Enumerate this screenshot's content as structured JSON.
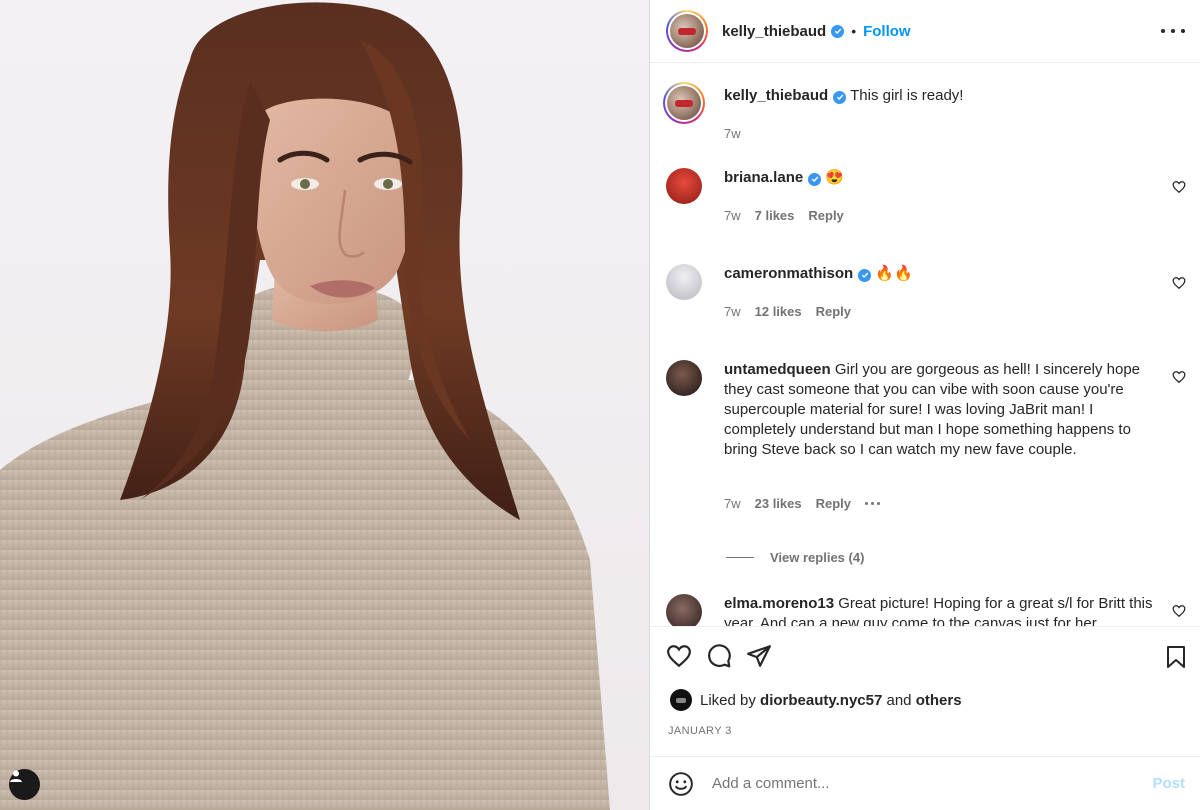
{
  "post": {
    "author": "kelly_thiebaud",
    "follow_label": "Follow",
    "dot": "•"
  },
  "caption": {
    "username": "kelly_thiebaud",
    "text": "This girl is ready!",
    "time": "7w"
  },
  "comments": [
    {
      "username": "briana.lane",
      "verified": true,
      "text": "😍",
      "time": "7w",
      "likes": "7 likes",
      "reply": "Reply",
      "avatar_color": "#b3261e"
    },
    {
      "username": "cameronmathison",
      "verified": true,
      "text": "🔥🔥",
      "time": "7w",
      "likes": "12 likes",
      "reply": "Reply",
      "avatar_color": "#c9c9d0"
    },
    {
      "username": "untamedqueen",
      "verified": false,
      "text": "Girl you are gorgeous as hell! I sincerely hope they cast someone that you can vibe with soon cause you're supercouple material for sure! I was loving JaBrit man! I completely understand but man I hope something happens to bring Steve back so I can watch my new fave couple.",
      "time": "7w",
      "likes": "23 likes",
      "reply": "Reply",
      "avatar_color": "#3a2a26"
    },
    {
      "username": "elma.moreno13",
      "verified": false,
      "text": "Great picture! Hoping for a great s/l for Britt this year. And can a new guy come to the canvas just for her",
      "avatar_color": "#4a3a38"
    }
  ],
  "view_replies": "View replies (4)",
  "likes_line": {
    "prefix": "Liked by",
    "user": "diorbeauty.nyc57",
    "mid": "and",
    "others": "others"
  },
  "date": "JANUARY 3",
  "add_comment": {
    "placeholder": "Add a comment...",
    "post_label": "Post"
  },
  "colors": {
    "accent": "#0095f6",
    "verified": "#3897f0",
    "muted": "#737373",
    "post_disabled": "#b2dffc"
  }
}
